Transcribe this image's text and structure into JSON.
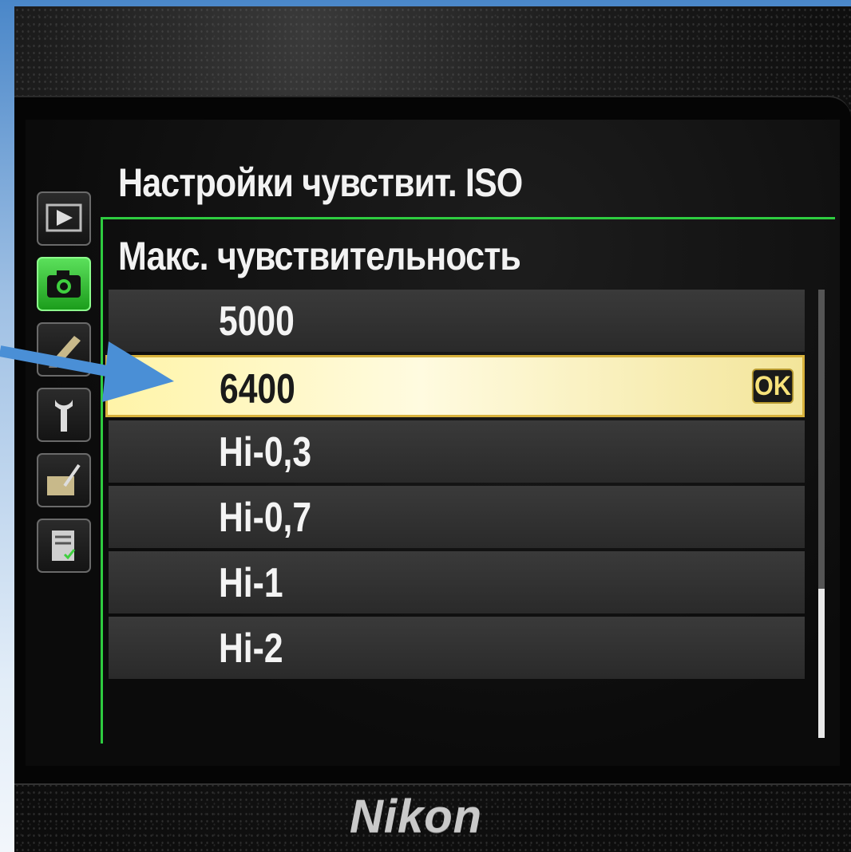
{
  "menu": {
    "title": "Настройки чувствит. ISO",
    "subtitle": "Макс. чувствительность"
  },
  "tabs": [
    {
      "icon": "playback-icon"
    },
    {
      "icon": "camera-icon",
      "active": true
    },
    {
      "icon": "pencil-icon"
    },
    {
      "icon": "wrench-icon"
    },
    {
      "icon": "retouch-icon"
    },
    {
      "icon": "recent-settings-icon"
    }
  ],
  "options": [
    {
      "label": "5000"
    },
    {
      "label": "6400",
      "selected": true,
      "confirm": "OK"
    },
    {
      "label": "Hi-0,3"
    },
    {
      "label": "Hi-0,7"
    },
    {
      "label": "Hi-1"
    },
    {
      "label": "Hi-2"
    }
  ],
  "brand": "Nikon",
  "colors": {
    "frame_accent": "#2ecc40",
    "selection_fill": "#fff4a8",
    "annotation_arrow": "#4a8fd6"
  }
}
